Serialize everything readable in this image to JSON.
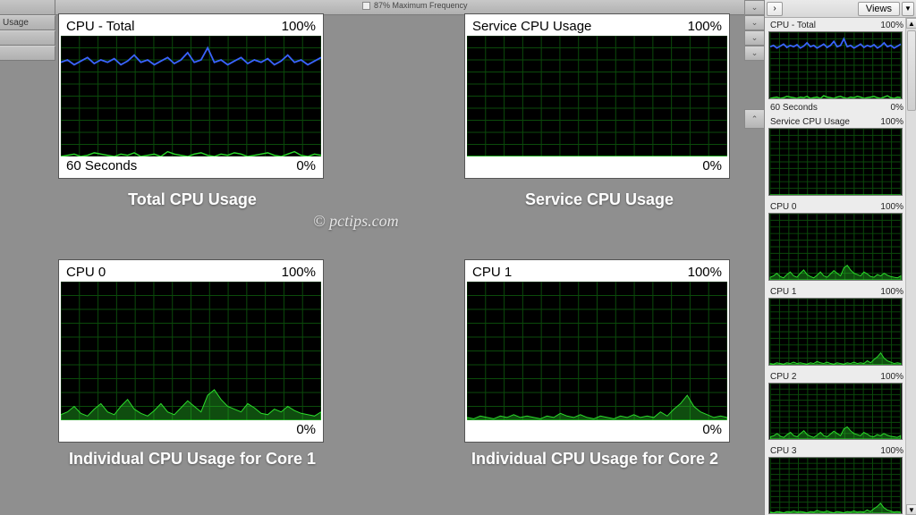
{
  "topbar": {
    "max_freq_label": "87% Maximum Frequency",
    "usage_strip": "Usage"
  },
  "sidebar": {
    "views_label": "Views",
    "thumbs": [
      {
        "title": "CPU - Total",
        "max": "100%",
        "footer_left": "60 Seconds",
        "footer_right": "0%"
      },
      {
        "title": "Service CPU Usage",
        "max": "100%"
      },
      {
        "title": "CPU 0",
        "max": "100%"
      },
      {
        "title": "CPU 1",
        "max": "100%"
      },
      {
        "title": "CPU 2",
        "max": "100%"
      },
      {
        "title": "CPU 3",
        "max": "100%"
      }
    ]
  },
  "charts": {
    "total": {
      "title": "CPU - Total",
      "max": "100%",
      "footer_left": "60 Seconds",
      "footer_right": "0%"
    },
    "service": {
      "title": "Service CPU Usage",
      "max": "100%",
      "footer_right": "0%"
    },
    "cpu0": {
      "title": "CPU 0",
      "max": "100%",
      "footer_right": "0%"
    },
    "cpu1": {
      "title": "CPU 1",
      "max": "100%",
      "footer_right": "0%"
    }
  },
  "captions": {
    "total": "Total CPU Usage",
    "service": "Service CPU Usage",
    "cpu0": "Individual CPU Usage for Core 1",
    "cpu1": "Individual CPU Usage for Core 2",
    "watermark": "© pctips.com"
  },
  "chart_data": [
    {
      "id": "total",
      "type": "line",
      "xlabel": "60 Seconds",
      "ylabel": "",
      "ylim": [
        0,
        100
      ],
      "series": [
        {
          "name": "blue",
          "color": "#3a63ff",
          "values": [
            78,
            80,
            76,
            79,
            82,
            77,
            80,
            78,
            81,
            76,
            79,
            84,
            78,
            80,
            76,
            79,
            82,
            77,
            80,
            86,
            78,
            80,
            90,
            78,
            80,
            76,
            79,
            82,
            77,
            80,
            78,
            81,
            76,
            79,
            84,
            78,
            80,
            76,
            79,
            82
          ]
        },
        {
          "name": "green",
          "color": "#2bdc2b",
          "values": [
            0,
            1,
            2,
            0,
            1,
            3,
            2,
            1,
            0,
            2,
            1,
            3,
            0,
            1,
            2,
            0,
            4,
            2,
            1,
            0,
            2,
            3,
            1,
            0,
            2,
            1,
            3,
            2,
            0,
            1,
            2,
            3,
            1,
            0,
            2,
            4,
            1,
            0,
            2,
            1
          ]
        }
      ]
    },
    {
      "id": "service",
      "type": "line",
      "ylim": [
        0,
        100
      ],
      "series": [
        {
          "name": "green",
          "color": "#2bdc2b",
          "values": [
            0,
            0,
            0,
            0,
            0,
            0,
            0,
            0,
            0,
            0,
            0,
            0,
            0,
            0,
            0,
            0,
            0,
            0,
            0,
            0,
            0,
            0,
            0,
            0,
            0,
            0,
            0,
            0,
            0,
            0,
            0,
            0,
            0,
            0,
            0,
            0,
            0,
            0,
            0,
            0
          ]
        }
      ]
    },
    {
      "id": "cpu0",
      "type": "area",
      "ylim": [
        0,
        100
      ],
      "series": [
        {
          "name": "green",
          "color": "#2bdc2b",
          "values": [
            4,
            6,
            10,
            5,
            3,
            8,
            12,
            6,
            4,
            10,
            15,
            8,
            5,
            3,
            7,
            12,
            6,
            4,
            9,
            14,
            10,
            6,
            18,
            22,
            15,
            10,
            8,
            6,
            12,
            9,
            5,
            4,
            8,
            6,
            10,
            7,
            5,
            4,
            3,
            6
          ]
        }
      ]
    },
    {
      "id": "cpu1",
      "type": "area",
      "ylim": [
        0,
        100
      ],
      "series": [
        {
          "name": "green",
          "color": "#2bdc2b",
          "values": [
            2,
            1,
            3,
            2,
            1,
            3,
            2,
            4,
            2,
            3,
            2,
            1,
            3,
            2,
            5,
            3,
            2,
            4,
            2,
            1,
            3,
            2,
            1,
            3,
            2,
            4,
            2,
            3,
            2,
            6,
            3,
            8,
            12,
            18,
            10,
            6,
            4,
            2,
            3,
            2
          ]
        }
      ]
    }
  ]
}
